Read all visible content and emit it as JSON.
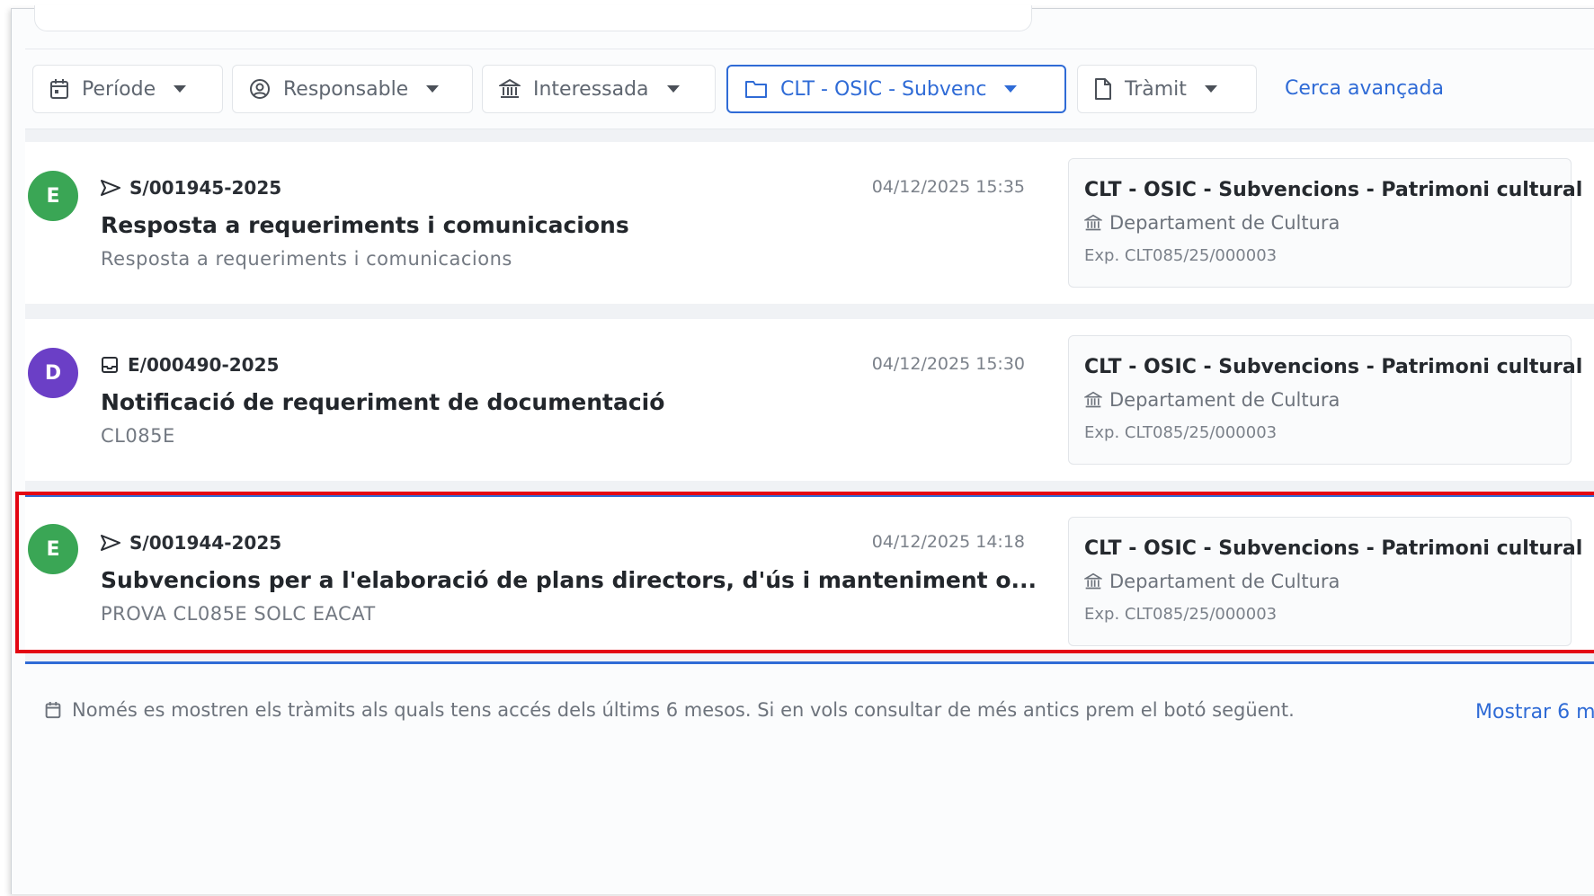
{
  "filters": [
    {
      "label": "Període",
      "icon": "calendar-icon",
      "active": false
    },
    {
      "label": "Responsable",
      "icon": "user-circle-icon",
      "active": false
    },
    {
      "label": "Interessada",
      "icon": "bank-icon",
      "active": false
    },
    {
      "label": "CLT - OSIC - Subvenc",
      "icon": "folder-icon",
      "active": true
    },
    {
      "label": "Tràmit",
      "icon": "document-icon",
      "active": false
    }
  ],
  "advanced_search_label": "Cerca avançada",
  "items": [
    {
      "avatar": "E",
      "avatar_color": "#3aa655",
      "ref_icon": "send-icon",
      "ref": "S/001945-2025",
      "date": "04/12/2025 15:35",
      "title": "Resposta a requeriments i comunicacions",
      "subtitle": "Resposta a requeriments i comunicacions",
      "card": {
        "title": "CLT - OSIC - Subvencions - Patrimoni cultural",
        "dept": "Departament de Cultura",
        "exp": "Exp. CLT085/25/000003"
      }
    },
    {
      "avatar": "D",
      "avatar_color": "#6b3fc6",
      "ref_icon": "inbox-icon",
      "ref": "E/000490-2025",
      "date": "04/12/2025 15:30",
      "title": "Notificació de requeriment de documentació",
      "subtitle": "CL085E",
      "card": {
        "title": "CLT - OSIC - Subvencions - Patrimoni cultural",
        "dept": "Departament de Cultura",
        "exp": "Exp. CLT085/25/000003"
      }
    },
    {
      "avatar": "E",
      "avatar_color": "#3aa655",
      "ref_icon": "send-icon",
      "ref": "S/001944-2025",
      "date": "04/12/2025 14:18",
      "title": "Subvencions per a l'elaboració de plans directors, d'ús i manteniment o...",
      "subtitle": "PROVA CL085E SOLC EACAT",
      "card": {
        "title": "CLT - OSIC - Subvencions - Patrimoni cultural",
        "dept": "Departament de Cultura",
        "exp": "Exp. CLT085/25/000003"
      }
    }
  ],
  "footer": {
    "note": "Només es mostren els tràmits als quals tens accés dels últims 6 mesos. Si en vols consultar de més antics prem el botó següent.",
    "more_label": "Mostrar 6 m"
  },
  "colors": {
    "accent": "#2f6bd6",
    "highlight": "#e30613"
  }
}
